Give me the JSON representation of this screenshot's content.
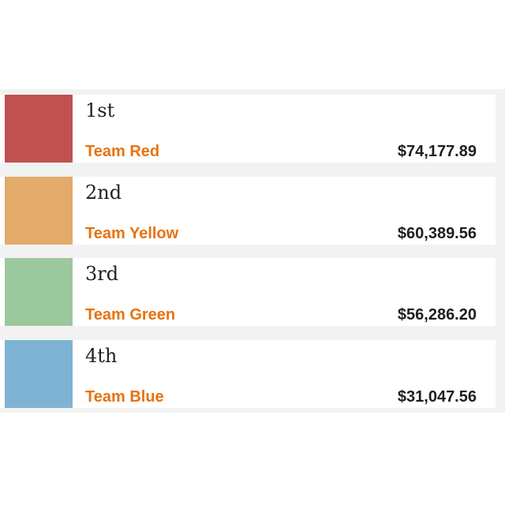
{
  "standings": [
    {
      "rank": "1st",
      "team": "Team Red",
      "amount": "$74,177.89",
      "color": "#c0514f"
    },
    {
      "rank": "2nd",
      "team": "Team Yellow",
      "amount": "$60,389.56",
      "color": "#e2ab6a"
    },
    {
      "rank": "3rd",
      "team": "Team Green",
      "amount": "$56,286.20",
      "color": "#9cc89e"
    },
    {
      "rank": "4th",
      "team": "Team Blue",
      "amount": "$31,047.56",
      "color": "#7fb3d3"
    }
  ],
  "colors": {
    "team_text": "#e8720e",
    "amount_text": "#1e1e1e",
    "rank_text": "#222222",
    "board_background": "#f2f2f2"
  }
}
